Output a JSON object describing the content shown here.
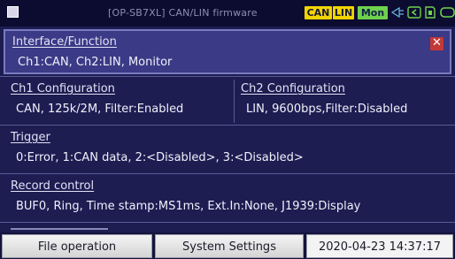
{
  "app": {
    "title": "[OP-SB7XL] CAN/LIN firmware",
    "badges": {
      "can": "CAN",
      "lin": "LIN",
      "mon": "Mon"
    },
    "colors": {
      "accent_yellow": "#f2d400",
      "accent_green": "#6fd14c",
      "close_red": "#c43838"
    }
  },
  "status_icons": [
    "signal-icon",
    "back-arrow-icon",
    "memory-card-icon",
    "battery-icon"
  ],
  "panels": {
    "interface": {
      "heading": "Interface/Function",
      "value": "Ch1:CAN, Ch2:LIN, Monitor",
      "close_symbol": "✕"
    },
    "ch1": {
      "heading": "Ch1 Configuration",
      "value": "CAN, 125k/2M, Filter:Enabled"
    },
    "ch2": {
      "heading": "Ch2 Configuration",
      "value": "LIN, 9600bps,Filter:Disabled"
    },
    "trigger": {
      "heading": "Trigger",
      "value": "0:Error, 1:CAN data, 2:<Disabled>, 3:<Disabled>"
    },
    "record": {
      "heading": "Record control",
      "value": "BUF0, Ring, Time stamp:MS1ms, Ext.In:None, J1939:Display"
    }
  },
  "bottom": {
    "file_operation": "File operation",
    "system_settings": "System Settings",
    "datetime": "2020-04-23 14:37:17"
  }
}
